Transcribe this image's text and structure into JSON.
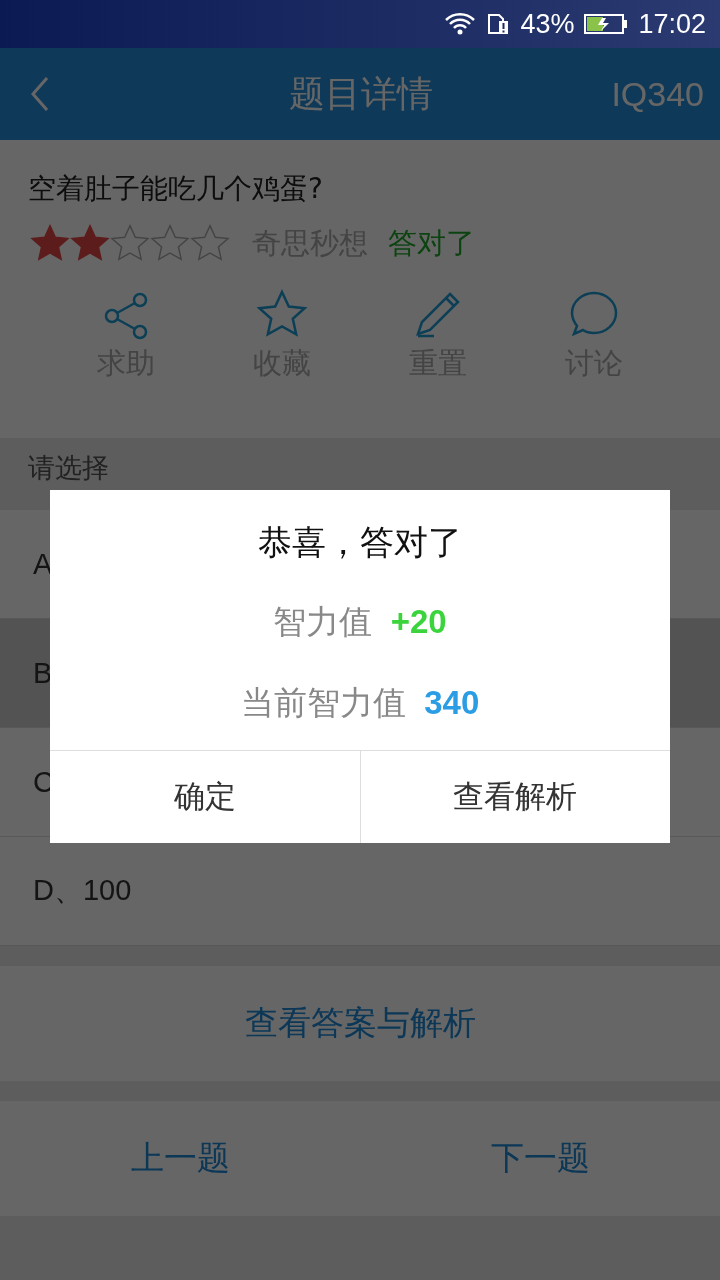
{
  "status_bar": {
    "battery": "43%",
    "time": "17:02"
  },
  "header": {
    "title": "题目详情",
    "code": "IQ340"
  },
  "question": {
    "text": "空着肚子能吃几个鸡蛋?",
    "stars": 2,
    "category": "奇思秒想",
    "result": "答对了"
  },
  "actions": [
    {
      "kind": "share",
      "label": "求助"
    },
    {
      "kind": "star",
      "label": "收藏"
    },
    {
      "kind": "pencil",
      "label": "重置"
    },
    {
      "kind": "chat",
      "label": "讨论"
    }
  ],
  "prompt": "请选择",
  "options": [
    {
      "label": "A",
      "selected": false
    },
    {
      "label": "B",
      "selected": true
    },
    {
      "label": "C",
      "selected": false
    },
    {
      "label": "D、100",
      "selected": false
    }
  ],
  "answer_button": "查看答案与解析",
  "nav": [
    "上一题",
    "下一题"
  ],
  "dialog": {
    "title": "恭喜，答对了",
    "lines": [
      {
        "kind": "gain",
        "label": "智力值",
        "value": "+20"
      },
      {
        "kind": "total",
        "label": "当前智力值",
        "value": "340"
      }
    ],
    "buttons": [
      "确定",
      "查看解析"
    ]
  }
}
